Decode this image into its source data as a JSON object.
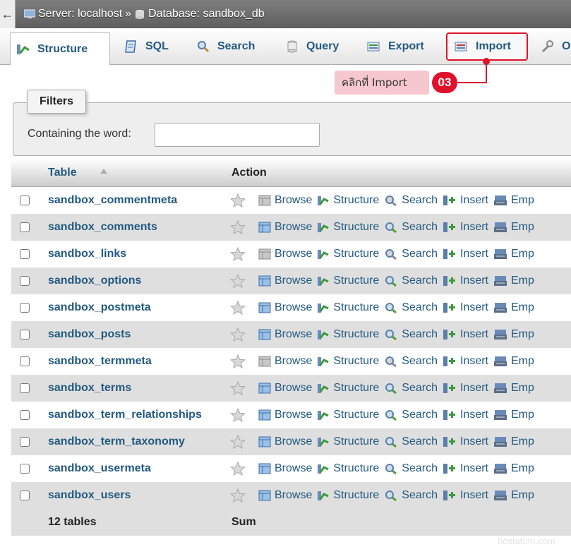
{
  "breadcrumb": {
    "back_symbol": "←",
    "server": "Server: localhost",
    "separator": "»",
    "database": "Database: sandbox_db"
  },
  "tabs": [
    {
      "label": "Structure",
      "icon": "structure-icon"
    },
    {
      "label": "SQL",
      "icon": "sql-icon"
    },
    {
      "label": "Search",
      "icon": "search-icon"
    },
    {
      "label": "Query",
      "icon": "query-icon"
    },
    {
      "label": "Export",
      "icon": "export-icon"
    },
    {
      "label": "Import",
      "icon": "import-icon"
    },
    {
      "label": "O",
      "icon": "operations-icon"
    }
  ],
  "callout": {
    "text": "คลิกที่ Import",
    "badge": "03"
  },
  "filters": {
    "legend": "Filters",
    "label": "Containing the word:",
    "value": ""
  },
  "table": {
    "columns": {
      "table": "Table",
      "action": "Action"
    },
    "actions": [
      "Browse",
      "Structure",
      "Search",
      "Insert",
      "Emp"
    ],
    "rows": [
      {
        "name": "sandbox_commentmeta",
        "empty": true
      },
      {
        "name": "sandbox_comments",
        "empty": false
      },
      {
        "name": "sandbox_links",
        "empty": true
      },
      {
        "name": "sandbox_options",
        "empty": false
      },
      {
        "name": "sandbox_postmeta",
        "empty": false
      },
      {
        "name": "sandbox_posts",
        "empty": false
      },
      {
        "name": "sandbox_termmeta",
        "empty": true
      },
      {
        "name": "sandbox_terms",
        "empty": false
      },
      {
        "name": "sandbox_term_relationships",
        "empty": false
      },
      {
        "name": "sandbox_term_taxonomy",
        "empty": false
      },
      {
        "name": "sandbox_usermeta",
        "empty": false
      },
      {
        "name": "sandbox_users",
        "empty": false
      }
    ],
    "footer": {
      "count": "12 tables",
      "sum": "Sum"
    }
  },
  "watermark": "hostatom.com",
  "colors": {
    "accent": "#e0112b",
    "link": "#235a81",
    "callout_bg": "#f7c7cf"
  }
}
